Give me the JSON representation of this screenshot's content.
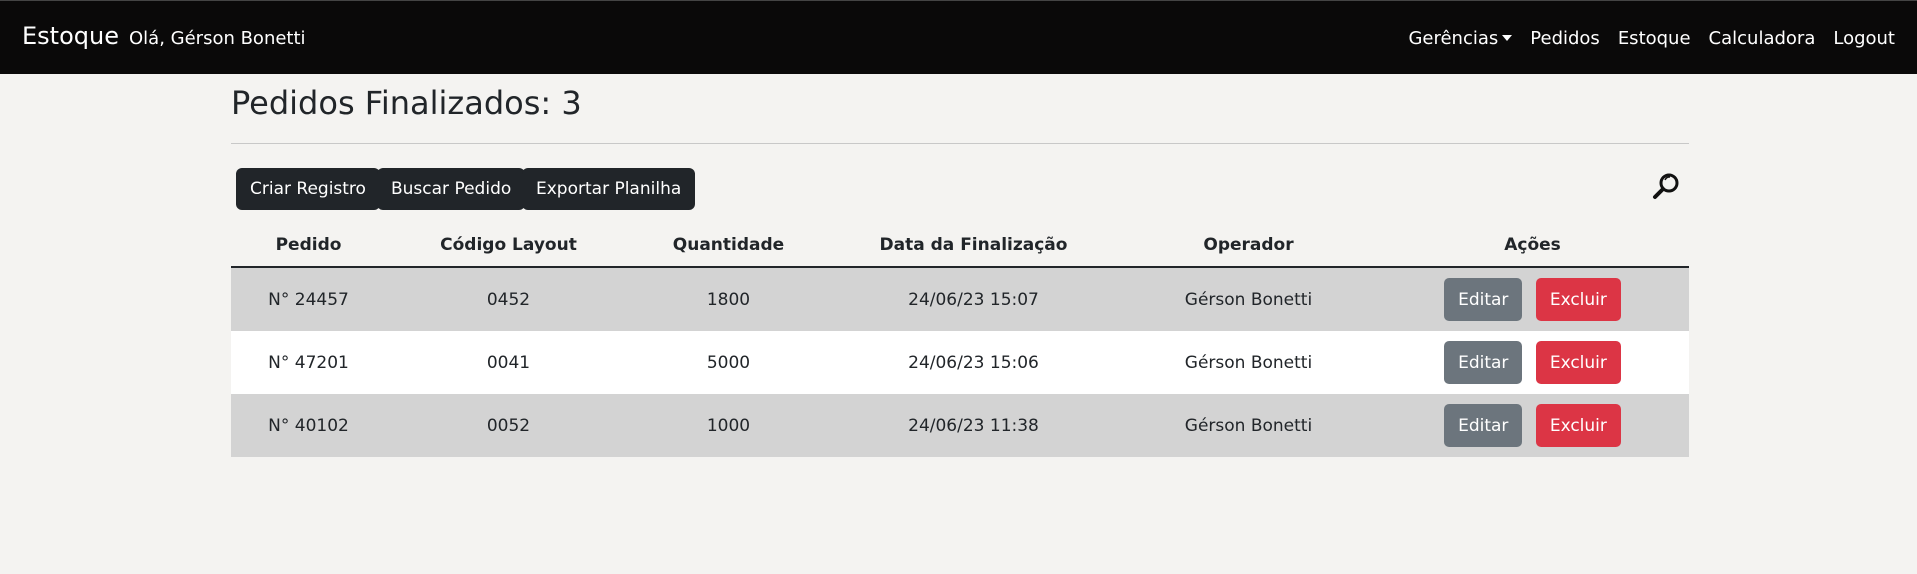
{
  "navbar": {
    "brand": "Estoque",
    "greeting": "Olá, Gérson Bonetti",
    "links": [
      "Gerências",
      "Pedidos",
      "Estoque",
      "Calculadora",
      "Logout"
    ]
  },
  "page": {
    "title": "Pedidos Finalizados: 3"
  },
  "toolbar": {
    "create_label": "Criar Registro",
    "search_order_label": "Buscar Pedido",
    "export_label": "Exportar Planilha"
  },
  "table": {
    "headers": [
      "Pedido",
      "Código Layout",
      "Quantidade",
      "Data da Finalização",
      "Operador",
      "Ações"
    ],
    "rows": [
      {
        "pedido": "N° 24457",
        "codigo": "0452",
        "quantidade": "1800",
        "data": "24/06/23 15:07",
        "operador": "Gérson Bonetti"
      },
      {
        "pedido": "N° 47201",
        "codigo": "0041",
        "quantidade": "5000",
        "data": "24/06/23 15:06",
        "operador": "Gérson Bonetti"
      },
      {
        "pedido": "N° 40102",
        "codigo": "0052",
        "quantidade": "1000",
        "data": "24/06/23 11:38",
        "operador": "Gérson Bonetti"
      }
    ],
    "edit_label": "Editar",
    "delete_label": "Excluir"
  }
}
